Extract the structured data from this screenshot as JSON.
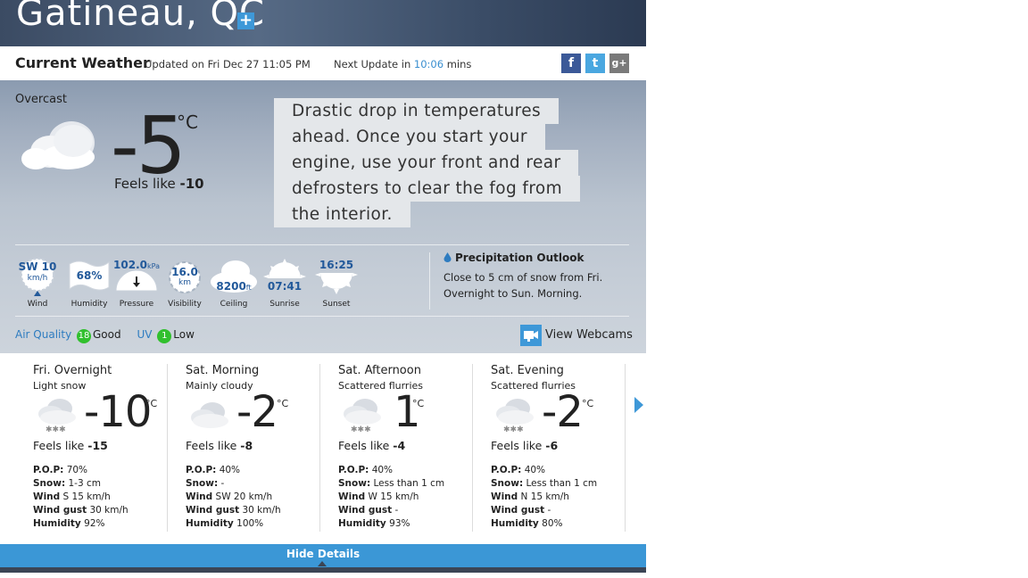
{
  "header": {
    "city": "Gatineau, QC",
    "add_icon": "plus-icon",
    "add_label": "+"
  },
  "current_bar": {
    "title": "Current Weather",
    "updated": "Updated on Fri Dec 27 11:05 PM",
    "next_update_prefix": "Next Update in ",
    "next_update_time": "10:06",
    "next_update_suffix": " mins",
    "social": [
      {
        "name": "facebook",
        "glyph": "f"
      },
      {
        "name": "twitter",
        "glyph": "t"
      },
      {
        "name": "googleplus",
        "glyph": "g+"
      }
    ]
  },
  "current": {
    "condition": "Overcast",
    "icon": "cloud-icon",
    "temp": "-5",
    "unit": "°C",
    "feels_label": "Feels like ",
    "feels_value": "-10",
    "tip_lines": [
      "Drastic drop in temperatures",
      "ahead. Once you start your",
      "engine, use your front and rear",
      "defrosters to clear the fog from",
      "the interior."
    ],
    "metrics": {
      "wind": {
        "value": "SW 10",
        "unit": "km/h",
        "label": "Wind"
      },
      "humidity": {
        "value": "68%",
        "label": "Humidity"
      },
      "pressure": {
        "value": "102.0",
        "unit": "kPa",
        "label": "Pressure"
      },
      "visibility": {
        "value": "16.0",
        "unit": "km",
        "label": "Visibility"
      },
      "ceiling": {
        "value": "8200",
        "unit": "ft",
        "label": "Ceiling"
      },
      "sunrise": {
        "value": "07:41",
        "label": "Sunrise"
      },
      "sunset": {
        "value": "16:25",
        "label": "Sunset"
      }
    },
    "precip_title": "Precipitation Outlook",
    "precip_text": "Close to 5 cm of snow from Fri. Overnight to Sun. Morning.",
    "air_quality_label": "Air Quality",
    "air_quality_value": "18",
    "air_quality_text": "Good",
    "uv_label": "UV",
    "uv_value": "1",
    "uv_text": "Low",
    "webcams_label": "View Webcams"
  },
  "forecast": [
    {
      "name": "Fri. Overnight",
      "condition": "Light snow",
      "temp": "-10",
      "unit": "°C",
      "feels_label": "Feels like ",
      "feels": "-15",
      "pop_label": "P.O.P:",
      "pop": "70%",
      "snow_label": "Snow:",
      "snow": "1-3 cm",
      "wind_label": "Wind",
      "wind": "S 15 km/h",
      "gust_label": "Wind gust",
      "gust": "30 km/h",
      "humidity_label": "Humidity",
      "humidity": "92%"
    },
    {
      "name": "Sat. Morning",
      "condition": "Mainly cloudy",
      "temp": "-2",
      "unit": "°C",
      "feels_label": "Feels like ",
      "feels": "-8",
      "pop_label": "P.O.P:",
      "pop": "40%",
      "snow_label": "Snow:",
      "snow": "-",
      "wind_label": "Wind",
      "wind": "SW 20 km/h",
      "gust_label": "Wind gust",
      "gust": "30 km/h",
      "humidity_label": "Humidity",
      "humidity": "100%"
    },
    {
      "name": "Sat. Afternoon",
      "condition": "Scattered flurries",
      "temp": "1",
      "unit": "°C",
      "feels_label": "Feels like ",
      "feels": "-4",
      "pop_label": "P.O.P:",
      "pop": "40%",
      "snow_label": "Snow:",
      "snow": "Less than 1 cm",
      "wind_label": "Wind",
      "wind": "W 15 km/h",
      "gust_label": "Wind gust",
      "gust": "-",
      "humidity_label": "Humidity",
      "humidity": "93%"
    },
    {
      "name": "Sat. Evening",
      "condition": "Scattered flurries",
      "temp": "-2",
      "unit": "°C",
      "feels_label": "Feels like ",
      "feels": "-6",
      "pop_label": "P.O.P:",
      "pop": "40%",
      "snow_label": "Snow:",
      "snow": "Less than 1 cm",
      "wind_label": "Wind",
      "wind": "N 15 km/h",
      "gust_label": "Wind gust",
      "gust": "-",
      "humidity_label": "Humidity",
      "humidity": "80%"
    }
  ],
  "footer": {
    "hide_label": "Hide Details"
  },
  "colors": {
    "accent": "#3e98d8",
    "link": "#2e7cc0",
    "metric_value": "#22599a",
    "good_badge": "#31c02e"
  }
}
